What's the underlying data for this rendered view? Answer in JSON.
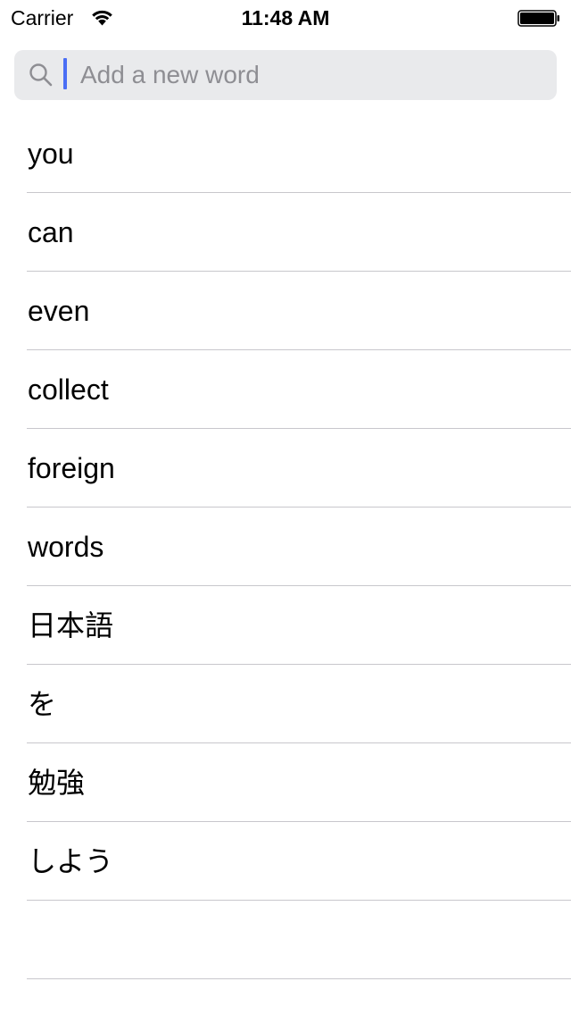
{
  "status_bar": {
    "carrier": "Carrier",
    "time": "11:48 AM",
    "wifi_icon": "wifi-icon",
    "battery_icon": "battery-icon",
    "battery_level": 1.0
  },
  "search": {
    "placeholder": "Add a new word",
    "value": "",
    "icon": "search-icon"
  },
  "words": [
    {
      "label": "you"
    },
    {
      "label": "can"
    },
    {
      "label": "even"
    },
    {
      "label": "collect"
    },
    {
      "label": "foreign"
    },
    {
      "label": "words"
    },
    {
      "label": "日本語"
    },
    {
      "label": "を"
    },
    {
      "label": "勉強"
    },
    {
      "label": "しよう"
    },
    {
      "label": ""
    }
  ],
  "colors": {
    "caret": "#4a6ef5",
    "search_background": "#e9eaec",
    "separator": "#c8c7cc",
    "placeholder": "#8e8e93"
  }
}
